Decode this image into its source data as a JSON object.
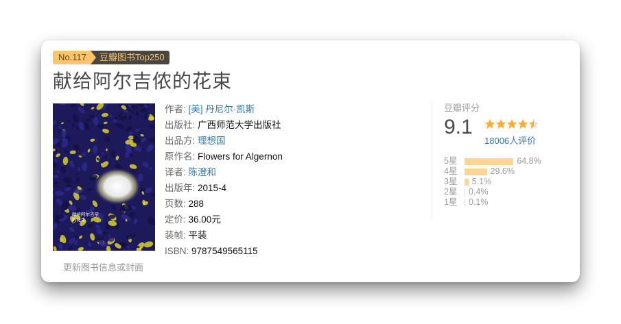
{
  "badge": {
    "rank": "No.117",
    "list": "豆瓣图书Top250"
  },
  "book": {
    "title": "献给阿尔吉侬的花束",
    "update_link": "更新图书信息或封面",
    "cover": {
      "title_lines": [
        "献给阿尔吉侬",
        "的花束"
      ],
      "colors": {
        "bg": "#1d1a5c",
        "accent": "#d9cf2e",
        "glow": "#ffffff"
      }
    }
  },
  "info": {
    "author": {
      "label": "作者:",
      "value": "[美] 丹尼尔·凯斯"
    },
    "publisher": {
      "label": "出版社:",
      "value": "广西师范大学出版社"
    },
    "producer": {
      "label": "出品方:",
      "value": "理想国"
    },
    "original_title": {
      "label": "原作名:",
      "value": "Flowers for Algernon"
    },
    "translator": {
      "label": "译者:",
      "value": "陈澄和"
    },
    "pub_year": {
      "label": "出版年:",
      "value": "2015-4"
    },
    "pages": {
      "label": "页数:",
      "value": "288"
    },
    "price": {
      "label": "定价:",
      "value": "36.00元"
    },
    "binding": {
      "label": "装帧:",
      "value": "平装"
    },
    "isbn": {
      "label": "ISBN:",
      "value": "9787549565115"
    }
  },
  "rating": {
    "title": "豆瓣评分",
    "score": "9.1",
    "stars": 4.5,
    "votes": "18006人评价",
    "distribution": [
      {
        "label": "5星",
        "pct": "64.8%",
        "value": 64.8
      },
      {
        "label": "4星",
        "pct": "29.6%",
        "value": 29.6
      },
      {
        "label": "3星",
        "pct": "5.1%",
        "value": 5.1
      },
      {
        "label": "2星",
        "pct": "0.4%",
        "value": 0.4
      },
      {
        "label": "1星",
        "pct": "0.1%",
        "value": 0.1
      }
    ],
    "colors": {
      "star": "#ffac2d",
      "star_empty": "#e0e0e0",
      "bar": "#ffd596",
      "link": "#3377aa"
    }
  }
}
